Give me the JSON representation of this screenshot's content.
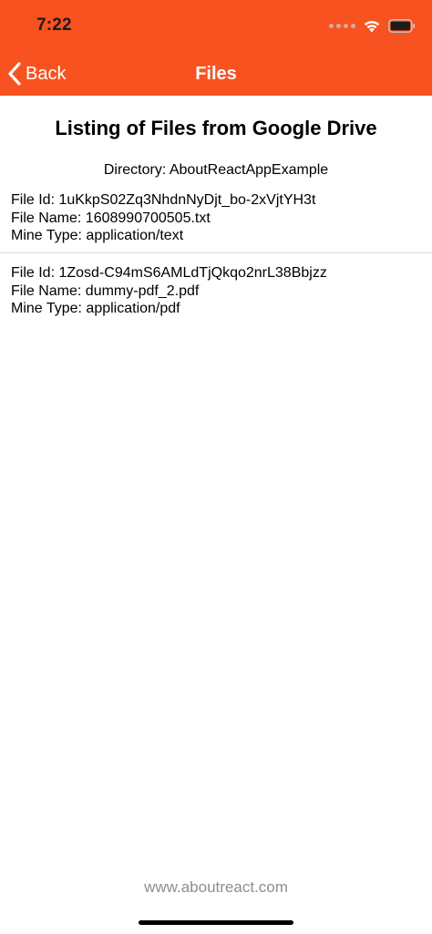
{
  "status_bar": {
    "time": "7:22"
  },
  "nav": {
    "back_label": "Back",
    "title": "Files"
  },
  "page": {
    "title": "Listing of Files from Google Drive",
    "directory": "Directory: AboutReactAppExample"
  },
  "files": [
    {
      "id_line": "File Id: 1uKkpS02Zq3NhdnNyDjt_bo-2xVjtYH3t",
      "name_line": "File Name: 1608990700505.txt",
      "type_line": "Mine Type: application/text"
    },
    {
      "id_line": "File Id: 1Zosd-C94mS6AMLdTjQkqo2nrL38Bbjzz",
      "name_line": "File Name: dummy-pdf_2.pdf",
      "type_line": "Mine Type: application/pdf"
    }
  ],
  "footer": {
    "text": "www.aboutreact.com"
  },
  "colors": {
    "accent": "#f85220",
    "footer_text": "#8e8e8e",
    "divider": "#d9d9d9"
  },
  "icons": [
    "wifi-icon",
    "battery-icon",
    "chevron-left-icon",
    "signal-icon"
  ]
}
